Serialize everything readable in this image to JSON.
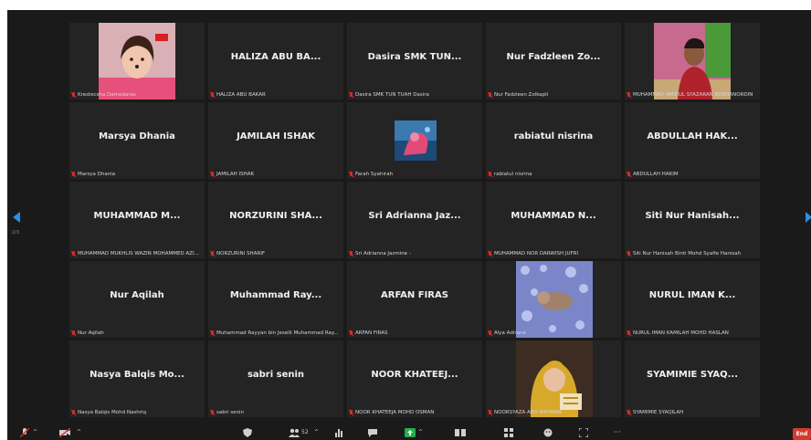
{
  "gallery": {
    "tiles": [
      {
        "name": "",
        "label": "Krestecsha Damodaras"
      },
      {
        "name": "HALIZA ABU BA...",
        "label": "HALIZA ABU BAKAR"
      },
      {
        "name": "Dasira SMK TUN...",
        "label": "Dasira SMK TUN TUAH Dasira"
      },
      {
        "name": "Nur Fadzleen Zo...",
        "label": "Nur Fadzleen Zolkapli"
      },
      {
        "name": "",
        "label": "MUHAMMAD AMIRUL SYAZARAN BOKHANORDIN"
      },
      {
        "name": "Marsya Dhania",
        "label": "Marsya Dhania"
      },
      {
        "name": "JAMILAH ISHAK",
        "label": "JAMILAH ISHAK"
      },
      {
        "name": "",
        "label": "Farah Syahirah"
      },
      {
        "name": "rabiatul nisrina",
        "label": "rabiatul nisrina"
      },
      {
        "name": "ABDULLAH HAK...",
        "label": "ABDULLAH HAKIM"
      },
      {
        "name": "MUHAMMAD M...",
        "label": "MUHAMMAD MUKHLIS WAZIN MOHAMMED AZI..."
      },
      {
        "name": "NORZURINI SHA...",
        "label": "NORZURINI SHARIF"
      },
      {
        "name": "Sri Adrianna Jaz...",
        "label": "Sri Adrianna Jazmine -"
      },
      {
        "name": "MUHAMMAD N...",
        "label": "MUHAMMAD NOR DARWISH JUFRI"
      },
      {
        "name": "Siti Nur Hanisah...",
        "label": "Siti Nur Hanisah Binti Mohd Syafie Hanisah"
      },
      {
        "name": "Nur Aqilah",
        "label": "Nur Aqilah"
      },
      {
        "name": "Muhammad Ray...",
        "label": "Muhammad Rayyan bin Jeselli Muhammad Ray..."
      },
      {
        "name": "ARFAN FIRAS",
        "label": "ARFAN FIRAS"
      },
      {
        "name": "",
        "label": "Alya Adriana"
      },
      {
        "name": "NURUL IMAN K...",
        "label": "NURUL IMAN KAMILAH MOHD HASLAN"
      },
      {
        "name": "Nasya Balqis Mo...",
        "label": "Nasya Balqis Mohd Nashriq"
      },
      {
        "name": "sabri senin",
        "label": "sabri senin"
      },
      {
        "name": "NOOR KHATEEJ...",
        "label": "NOOR KHATEEJA MOHD OSMAN"
      },
      {
        "name": "",
        "label": "NOORSYAZA ABD RAHMAN"
      },
      {
        "name": "SYAMIMIE SYAQ...",
        "label": "SYAMIMIE SYAQILAH"
      }
    ]
  },
  "nav": {
    "page_indicator": "2/3"
  },
  "toolbar": {
    "participants_count": "52",
    "end_label": "End"
  },
  "colors": {
    "mute_red": "#e02828",
    "nav_blue": "#2b8fe8",
    "end_red": "#d43b2f"
  }
}
